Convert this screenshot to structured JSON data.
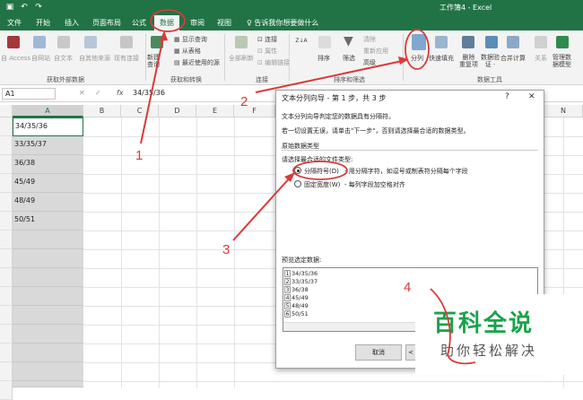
{
  "window": {
    "title": "工作簿4 - Excel"
  },
  "quick_access": {
    "save_icon": "save-icon",
    "undo_icon": "undo-icon",
    "redo_icon": "redo-icon"
  },
  "tabs": [
    "文件",
    "开始",
    "插入",
    "页面布局",
    "公式",
    "数据",
    "审阅",
    "视图"
  ],
  "active_tab": "数据",
  "tell_me": "♀ 告诉我你想要做什么",
  "ribbon": {
    "get_external": [
      "自 Access",
      "自网站",
      "自文本",
      "自其他来源",
      "现有连接"
    ],
    "get_external_group": "获取外部数据",
    "new_query": "新建\n查询",
    "query_items": [
      "显示查询",
      "从表格",
      "最近使用的源"
    ],
    "get_transform_group": "获取和转换",
    "refresh_all": "全部刷新",
    "conn_items": [
      "连接",
      "属性",
      "编辑链接"
    ],
    "conn_group": "连接",
    "sort_az": "Z↓A",
    "sort_label": "排序",
    "filter_label": "筛选",
    "filter_items": [
      "清除",
      "重新应用",
      "高级"
    ],
    "sort_filter_group": "排序和筛选",
    "text_to_col": "分列",
    "flash_fill": "快速填充",
    "remove_dup": "删除\n重复项",
    "validation": "数据验\n证 ·",
    "consolidate": "合并计算",
    "relations": "关系",
    "manage_model": "管理数\n据模型",
    "data_tools_group": "数据工具"
  },
  "formula_bar": {
    "name_box": "A1",
    "fx": "fx",
    "value": "34/35/36"
  },
  "columns": [
    "A",
    "B",
    "C",
    "D",
    "E",
    "F",
    "N"
  ],
  "cells_a": [
    "34/35/36",
    "33/35/37",
    "36/38",
    "45/49",
    "48/49",
    "50/51"
  ],
  "dialog": {
    "title": "文本分列向导 - 第 1 步，共 3 步",
    "help": "?",
    "close": "✕",
    "intro1": "文本分列向导判定您的数据具有分隔符。",
    "intro2": "若一切设置无误，请单击\"下一步\"，否则请选择最合适的数据类型。",
    "orig_type": "原始数据类型",
    "choose_type": "请选择最合适的文件类型:",
    "opt_delimited": "分隔符号(D)",
    "opt_delimited_desc": "- 用分隔字符，如逗号或制表符分隔每个字段",
    "opt_fixed": "固定宽度(W)",
    "opt_fixed_desc": "- 每列字段加空格对齐",
    "preview_label": "预览选定数据:",
    "preview_rows": [
      "34/35/36",
      "33/35/37",
      "36/38",
      "45/49",
      "48/49",
      "50/51"
    ],
    "cancel": "取消",
    "back": "<"
  },
  "watermark": {
    "big": "百科全说",
    "small": "助你轻松解决"
  },
  "annotations": [
    "1",
    "2",
    "3",
    "4"
  ],
  "colors": {
    "excel_green": "#217346",
    "annotation_red": "#d93a3a",
    "watermark_green": "#1aa34a"
  }
}
